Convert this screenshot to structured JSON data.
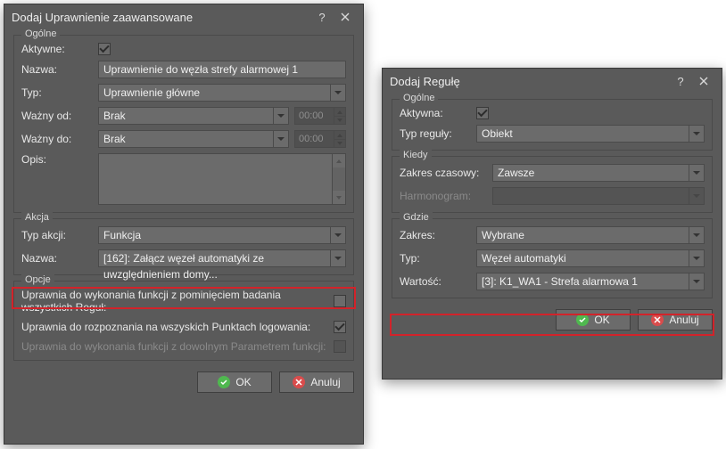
{
  "dialog1": {
    "title": "Dodaj Uprawnienie zaawansowane",
    "group_general": "Ogólne",
    "active_label": "Aktywne:",
    "name_label": "Nazwa:",
    "name_value": "Uprawnienie do węzła strefy alarmowej 1",
    "type_label": "Typ:",
    "type_value": "Uprawnienie główne",
    "valid_from_label": "Ważny od:",
    "valid_from_value": "Brak",
    "valid_from_time": "00:00",
    "valid_to_label": "Ważny do:",
    "valid_to_value": "Brak",
    "valid_to_time": "00:00",
    "desc_label": "Opis:",
    "group_action": "Akcja",
    "action_type_label": "Typ akcji:",
    "action_type_value": "Funkcja",
    "action_name_label": "Nazwa:",
    "action_name_value": "[162]: Załącz węzeł automatyki ze uwzględnieniem domy...",
    "group_options": "Opcje",
    "opt1": "Uprawnia do wykonania funkcji z pominięciem badania wszystkich Reguł:",
    "opt2": "Uprawnia do rozpoznania na wszyskich Punktach logowania:",
    "opt3": "Uprawnia do wykonania funkcji z dowolnym Parametrem funkcji:",
    "ok": "OK",
    "cancel": "Anuluj"
  },
  "dialog2": {
    "title": "Dodaj Regułę",
    "group_general": "Ogólne",
    "active_label": "Aktywna:",
    "rule_type_label": "Typ reguły:",
    "rule_type_value": "Obiekt",
    "group_when": "Kiedy",
    "time_range_label": "Zakres czasowy:",
    "time_range_value": "Zawsze",
    "schedule_label": "Harmonogram:",
    "group_where": "Gdzie",
    "range_label": "Zakres:",
    "range_value": "Wybrane",
    "type_label": "Typ:",
    "type_value": "Węzeł automatyki",
    "value_label": "Wartość:",
    "value_value": "[3]: K1_WA1 - Strefa alarmowa 1",
    "ok": "OK",
    "cancel": "Anuluj"
  }
}
